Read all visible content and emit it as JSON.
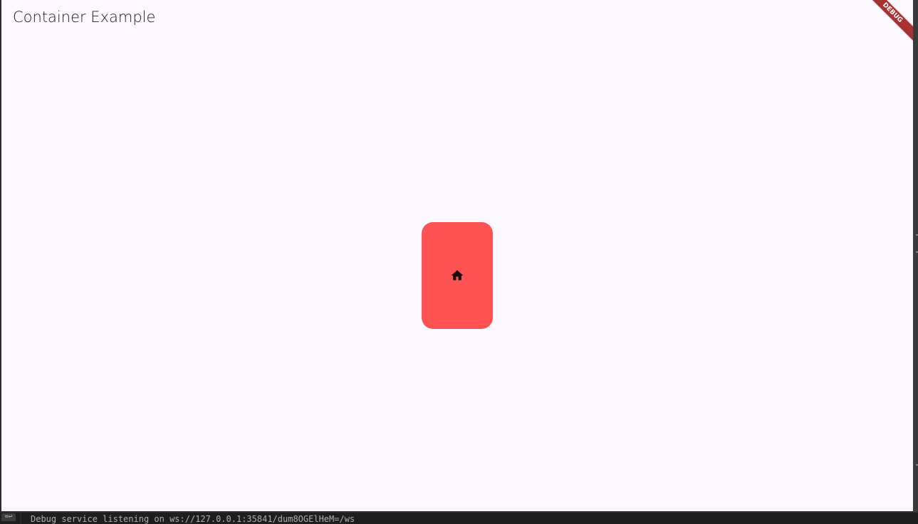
{
  "app": {
    "title": "Container Example",
    "background": "#fdf7ff"
  },
  "debug_banner": {
    "label": "DEBUG",
    "color": "#a83333"
  },
  "card": {
    "color": "#ff5252",
    "icon": "home-icon"
  },
  "console": {
    "wrap_icon": "wrap-lines-icon",
    "wrap_glyph": "=↩",
    "message": "Debug service listening on ws://127.0.0.1:35841/dum8OGElHeM=/ws"
  }
}
